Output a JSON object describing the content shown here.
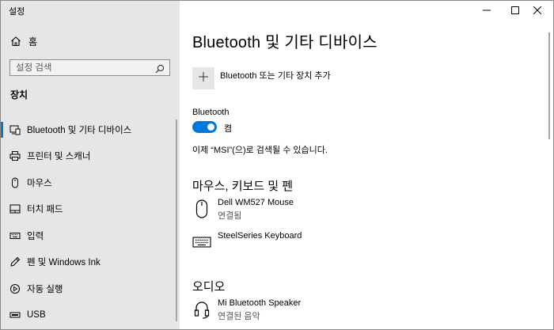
{
  "window": {
    "title": "설정"
  },
  "sidebar": {
    "home_label": "홈",
    "search_placeholder": "설정 검색",
    "section_title": "장치",
    "items": [
      {
        "label": "Bluetooth 및 기타 디바이스",
        "icon": "bluetooth-devices-icon",
        "active": true
      },
      {
        "label": "프린터 및 스캐너",
        "icon": "printer-icon",
        "active": false
      },
      {
        "label": "마우스",
        "icon": "mouse-icon",
        "active": false
      },
      {
        "label": "터치 패드",
        "icon": "touchpad-icon",
        "active": false
      },
      {
        "label": "입력",
        "icon": "keyboard-icon",
        "active": false
      },
      {
        "label": "펜 및 Windows Ink",
        "icon": "pen-icon",
        "active": false
      },
      {
        "label": "자동 실행",
        "icon": "autoplay-icon",
        "active": false
      },
      {
        "label": "USB",
        "icon": "usb-icon",
        "active": false
      }
    ]
  },
  "main": {
    "title": "Bluetooth 및 기타 디바이스",
    "add_device_label": "Bluetooth 또는 기타 장치 추가",
    "bluetooth_label": "Bluetooth",
    "toggle_state": "켬",
    "discoverable_text": "이제 “MSI”(으)로 검색될 수 있습니다.",
    "sections": {
      "mouse_keyboard_pen": {
        "heading": "마우스, 키보드 및 펜",
        "devices": [
          {
            "name": "Dell WM527 Mouse",
            "status": "연결됨",
            "icon": "mouse-icon"
          },
          {
            "name": "SteelSeries Keyboard",
            "status": "",
            "icon": "keyboard-icon"
          }
        ]
      },
      "audio": {
        "heading": "오디오",
        "devices": [
          {
            "name": "Mi Bluetooth Speaker",
            "status": "연결된 음악",
            "icon": "headphones-icon"
          }
        ]
      }
    }
  },
  "colors": {
    "accent": "#0078d7",
    "sidebar_bg": "#e6e6e6",
    "main_bg": "#ffffff"
  }
}
